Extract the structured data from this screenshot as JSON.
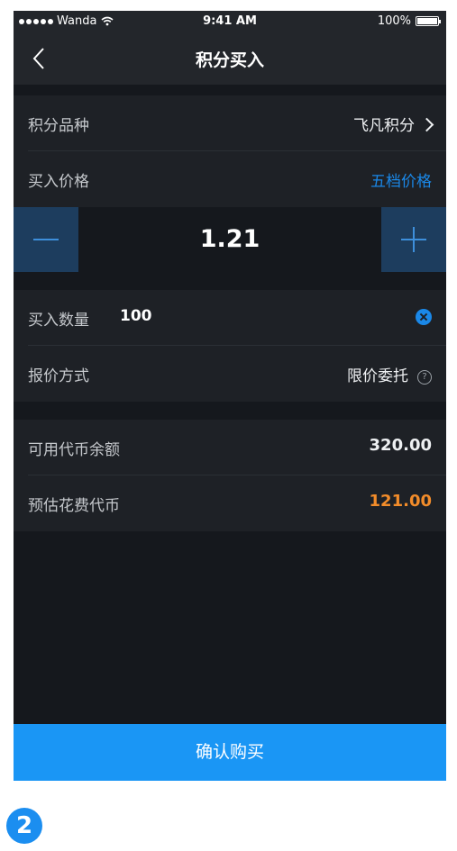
{
  "status_bar": {
    "carrier": "Wanda",
    "time": "9:41 AM",
    "battery": "100%",
    "battery_level": 1.0
  },
  "nav": {
    "title": "积分买入",
    "back_icon": "chevron-left-icon"
  },
  "points_type": {
    "label": "积分品种",
    "value": "飞凡积分"
  },
  "buy_price": {
    "label": "买入价格",
    "link": "五档价格",
    "value": "1.21"
  },
  "quantity": {
    "label": "买入数量",
    "value": "100"
  },
  "quote_method": {
    "label": "报价方式",
    "value": "限价委托",
    "help": "?"
  },
  "balance": {
    "label": "可用代币余额",
    "value": "320.00"
  },
  "estimated_cost": {
    "label": "预估花费代币",
    "value": "121.00"
  },
  "confirm_button": "确认购买",
  "step_badge": "2",
  "colors": {
    "accent": "#1a96f5",
    "link_blue": "#1a88e8",
    "orange": "#f28c2a",
    "background": "#15181d",
    "panel": "#1e2126"
  }
}
